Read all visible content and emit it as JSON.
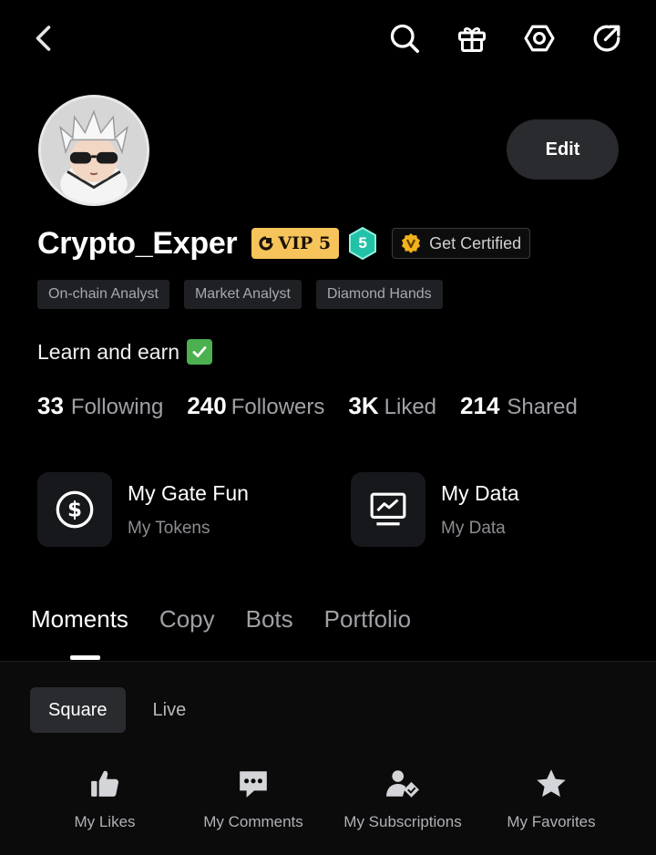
{
  "profile": {
    "username": "Crypto_Exper",
    "vip_label": "VIP 5",
    "level": "5",
    "certified_label": "Get Certified",
    "edit_label": "Edit",
    "tags": [
      "On-chain Analyst",
      "Market Analyst",
      "Diamond Hands"
    ],
    "bio": "Learn and earn"
  },
  "stats": [
    {
      "value": "33",
      "label": "Following"
    },
    {
      "value": "240",
      "label": "Followers"
    },
    {
      "value": "3K",
      "label": "Liked"
    },
    {
      "value": "214",
      "label": "Shared"
    }
  ],
  "cards": [
    {
      "title": "My Gate Fun",
      "subtitle": "My Tokens",
      "icon": "dollar-circle-icon"
    },
    {
      "title": "My Data",
      "subtitle": "My Data",
      "icon": "chart-monitor-icon"
    }
  ],
  "tabs": [
    {
      "label": "Moments",
      "active": true
    },
    {
      "label": "Copy",
      "active": false
    },
    {
      "label": "Bots",
      "active": false
    },
    {
      "label": "Portfolio",
      "active": false
    }
  ],
  "subtabs": [
    {
      "label": "Square",
      "active": true
    },
    {
      "label": "Live",
      "active": false
    }
  ],
  "shortcuts": [
    {
      "label": "My Likes",
      "icon": "thumbs-up-icon"
    },
    {
      "label": "My Comments",
      "icon": "comment-icon"
    },
    {
      "label": "My Subscriptions",
      "icon": "subscription-user-icon"
    },
    {
      "label": "My Favorites",
      "icon": "star-icon"
    }
  ],
  "colors": {
    "background": "#000000",
    "vip_gold": "#f6c45a",
    "level_teal": "#22c2a8",
    "check_green": "#4caf50"
  }
}
